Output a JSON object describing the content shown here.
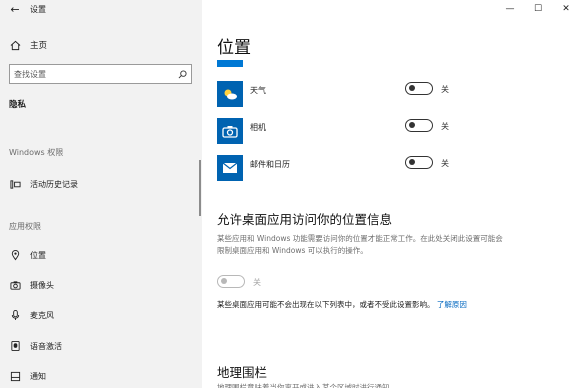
{
  "window": {
    "title": "设置",
    "controls": {
      "minimize": "—",
      "maximize": "☐",
      "close": "✕"
    }
  },
  "sidebar": {
    "home_label": "主页",
    "search_placeholder": "查找设置",
    "category": "隐私",
    "windows_permissions_header": "Windows 权限",
    "activity_history": "活动历史记录",
    "app_permissions_header": "应用权限",
    "items": [
      {
        "label": "位置",
        "icon": "location-pin-icon"
      },
      {
        "label": "摄像头",
        "icon": "camera-icon"
      },
      {
        "label": "麦克风",
        "icon": "microphone-icon"
      },
      {
        "label": "语音激活",
        "icon": "voice-activation-icon"
      },
      {
        "label": "通知",
        "icon": "notification-icon"
      }
    ]
  },
  "main": {
    "page_title": "位置",
    "apps": [
      {
        "name": "天气",
        "icon": "weather-icon",
        "toggle_state": "关"
      },
      {
        "name": "相机",
        "icon": "camera-app-icon",
        "toggle_state": "关"
      },
      {
        "name": "邮件和日历",
        "icon": "mail-icon",
        "toggle_state": "关"
      }
    ],
    "desktop_section": {
      "heading": "允许桌面应用访问你的位置信息",
      "description": "某些应用和 Windows 功能需要访问你的位置才能正常工作。在此处关闭此设置可能会限制桌面应用和 Windows 可以执行的操作。",
      "toggle_state": "关",
      "note": "某些桌面应用可能不会出现在以下列表中，或者不受此设置影响。",
      "link": "了解原因"
    },
    "geofence_heading": "地理围栏",
    "geofence_cut_text": "地理围栏意味着当你离开或进入某个区域时进行通知"
  },
  "colors": {
    "accent": "#0078d4",
    "tile": "#0063b1",
    "link": "#0067c0",
    "sidebar_bg": "#f2f2f2"
  }
}
